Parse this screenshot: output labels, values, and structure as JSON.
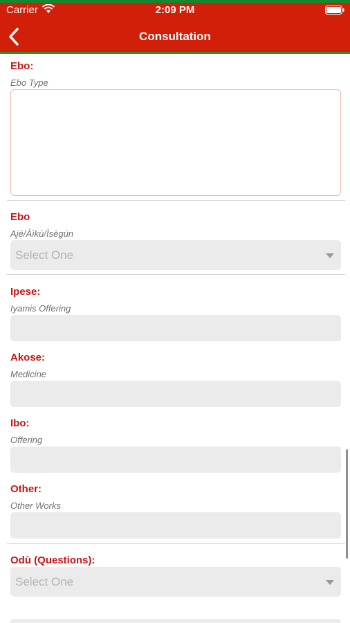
{
  "status": {
    "carrier": "Carrier",
    "time": "2:09 PM"
  },
  "nav": {
    "title": "Consultation"
  },
  "form": {
    "ebo_type": {
      "label": "Ebo:",
      "sublabel": "Ebo Type",
      "value": ""
    },
    "ebo": {
      "label": "Ebo",
      "sublabel": "Ajé/Àìkú/Ìsègún",
      "selected": "Select One"
    },
    "ipese": {
      "label": "Ipese:",
      "sublabel": "Iyamis Offering",
      "value": ""
    },
    "akose": {
      "label": "Akose:",
      "sublabel": "Medicine",
      "value": ""
    },
    "ibo": {
      "label": "Ibo:",
      "sublabel": "Offering",
      "value": ""
    },
    "other": {
      "label": "Other:",
      "sublabel": "Other Works",
      "value": ""
    },
    "odu": {
      "label": "Odù (Questions):",
      "selected": "Select One"
    }
  },
  "colors": {
    "header": "#d21f0a",
    "header_stripe": "#0f8a2e",
    "label": "#c81414",
    "field_bg": "#ebebeb"
  }
}
